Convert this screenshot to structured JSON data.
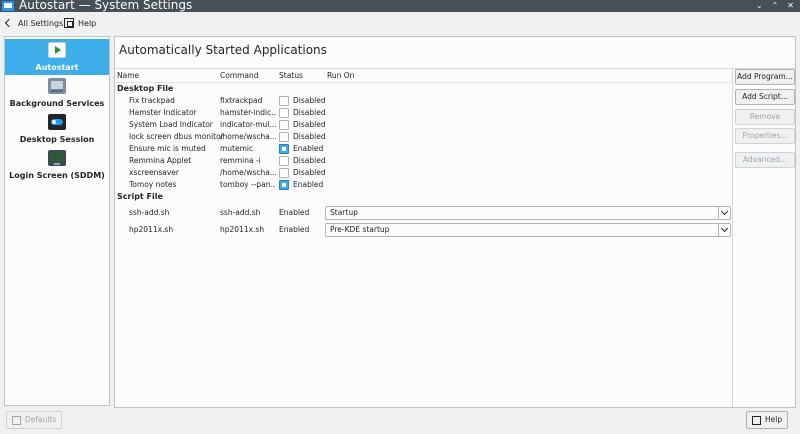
{
  "window": {
    "title": "Autostart  — System Settings",
    "controls": [
      "⌄",
      "⌃",
      "✕"
    ]
  },
  "toolbar": {
    "back_label": "All Settings",
    "help_label": "Help"
  },
  "sidebar": {
    "items": [
      {
        "label": "Autostart",
        "icon": "autostart-icon",
        "color": "#2d8f3e"
      },
      {
        "label": "Background Services",
        "icon": "background-services-icon",
        "color": "#7a8ea0"
      },
      {
        "label": "Desktop Session",
        "icon": "desktop-session-icon",
        "color": "#1d99f3"
      },
      {
        "label": "Login Screen (SDDM)",
        "icon": "login-screen-icon",
        "color": "#3c4a56"
      }
    ]
  },
  "main": {
    "title": "Automatically Started Applications",
    "columns": [
      "Name",
      "Command",
      "Status",
      "Run On"
    ],
    "desktop_group": "Desktop File",
    "desktop_rows": [
      {
        "name": "Fix trackpad",
        "command": "fixtrackpad",
        "enabled": false,
        "status": "Disabled"
      },
      {
        "name": "Hamster Indicator",
        "command": "hamster-indic...",
        "enabled": false,
        "status": "Disabled"
      },
      {
        "name": "System Load Indicator",
        "command": "indicator-mul...",
        "enabled": false,
        "status": "Disabled"
      },
      {
        "name": "lock screen dbus monitor",
        "command": "/home/wscha...",
        "enabled": false,
        "status": "Disabled"
      },
      {
        "name": "Ensure mic is muted",
        "command": "mutemic",
        "enabled": true,
        "status": "Enabled"
      },
      {
        "name": "Remmina Applet",
        "command": "remmina -i",
        "enabled": false,
        "status": "Disabled"
      },
      {
        "name": "xscreensaver",
        "command": "/home/wscha...",
        "enabled": false,
        "status": "Disabled"
      },
      {
        "name": "Tomoy notes",
        "command": "tomboy --pan...",
        "enabled": true,
        "status": "Enabled"
      }
    ],
    "script_group": "Script File",
    "script_rows": [
      {
        "name": "ssh-add.sh",
        "command": "ssh-add.sh",
        "status": "Enabled",
        "run_on": "Startup"
      },
      {
        "name": "hp2011x.sh",
        "command": "hp2011x.sh",
        "status": "Enabled",
        "run_on": "Pre-KDE startup"
      }
    ]
  },
  "buttons": {
    "add_program": "Add Program...",
    "add_script": "Add Script...",
    "remove": "Remove",
    "properties": "Properties...",
    "advanced": "Advanced..."
  },
  "footer": {
    "defaults": "Defaults",
    "help": "Help"
  },
  "colors": {
    "accent": "#3daee9",
    "titlebar": "#475057"
  }
}
